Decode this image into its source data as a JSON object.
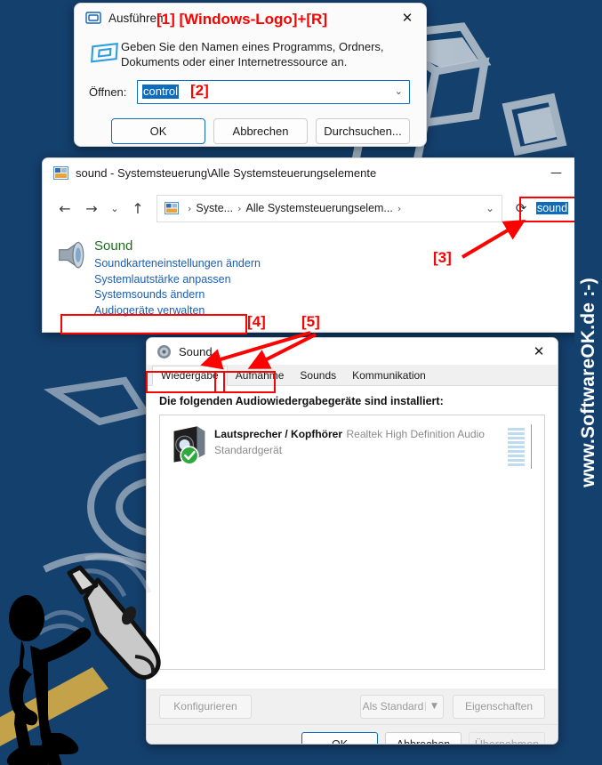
{
  "page": {
    "background_color": "#14406e",
    "accent_red": "#ff0000",
    "watermark_side": "www.SoftwareOK.de  :-)"
  },
  "run_dialog": {
    "title": "Ausführen",
    "icon": "run-window-icon",
    "close_icon": "✕",
    "description": "Geben Sie den Namen eines Programms, Ordners, Dokuments oder einer Internetressource an.",
    "open_label": "Öffnen:",
    "open_value": "control",
    "combo_caret": "⌄",
    "buttons": {
      "ok": "OK",
      "cancel": "Abbrechen",
      "browse": "Durchsuchen..."
    }
  },
  "control_panel": {
    "title": "sound - Systemsteuerung\\Alle Systemsteuerungselemente",
    "icon": "control-panel-icon",
    "minimize_icon": "—",
    "maximize_icon": "❐",
    "nav": {
      "back_icon": "←",
      "forward_icon": "→",
      "history_icon": "⌄",
      "up_icon": "↑",
      "refresh_icon": "⟳",
      "dropdown_icon": "⌄",
      "crumb_icon": "control-panel-icon",
      "crumbs": [
        "Syste...",
        "Alle Systemsteuerungselem..."
      ],
      "separator": "›"
    },
    "search_value": "sound",
    "result": {
      "icon": "speaker-icon",
      "heading": "Sound",
      "links": [
        "Soundkarteneinstellungen ändern",
        "Systemlautstärke anpassen",
        "Systemsounds ändern",
        "Audiogeräte verwalten"
      ]
    }
  },
  "sound_dialog": {
    "title": "Sound",
    "icon": "sound-icon",
    "close_icon": "✕",
    "tabs": [
      {
        "label": "Wiedergabe",
        "active": true
      },
      {
        "label": "Aufnahme",
        "active": false
      },
      {
        "label": "Sounds",
        "active": false
      },
      {
        "label": "Kommunikation",
        "active": false
      }
    ],
    "caption": "Die folgenden Audiowiedergabegeräte sind installiert:",
    "devices": [
      {
        "icon": "speaker-device-icon",
        "badge": "default-check-badge",
        "name": "Lautsprecher / Kopfhörer",
        "driver": "Realtek High Definition Audio",
        "status": "Standardgerät",
        "meter_segments": 9
      }
    ],
    "actions": {
      "configure": "Konfigurieren",
      "set_default": "Als Standard",
      "set_default_arrow": "▼",
      "properties": "Eigenschaften"
    },
    "footer": {
      "ok": "OK",
      "cancel": "Abbrechen",
      "apply": "Übernehmen"
    }
  },
  "annotations": [
    {
      "id": "a1",
      "label": "[1] [Windows-Logo]+[R]"
    },
    {
      "id": "a2",
      "label": "[2]"
    },
    {
      "id": "a3",
      "label": "[3]"
    },
    {
      "id": "a4",
      "label": "[4]"
    },
    {
      "id": "a5",
      "label": "[5]"
    }
  ]
}
